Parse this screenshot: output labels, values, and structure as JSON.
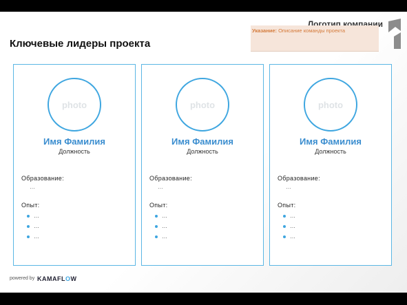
{
  "header": {
    "title": "Ключевые лидеры проекта",
    "logo_text": "Логотип компании",
    "note_label": "Указание:",
    "note_text": " Описание команды проекта"
  },
  "cards": [
    {
      "photo": "photo",
      "name": "Имя Фамилия",
      "position": "Должность",
      "education_label": "Образование:",
      "education_value": "…",
      "experience_label": "Опыт:",
      "experience_items": [
        "…",
        "…",
        "…"
      ]
    },
    {
      "photo": "photo",
      "name": "Имя Фамилия",
      "position": "Должность",
      "education_label": "Образование:",
      "education_value": "…",
      "experience_label": "Опыт:",
      "experience_items": [
        "…",
        "…",
        "…"
      ]
    },
    {
      "photo": "photo",
      "name": "Имя Фамилия",
      "position": "Должность",
      "education_label": "Образование:",
      "education_value": "…",
      "experience_label": "Опыт:",
      "experience_items": [
        "…",
        "…",
        "…"
      ]
    }
  ],
  "footer": {
    "powered_by": "powered by",
    "brand": "KAMAFL",
    "brand_o": "O",
    "brand_end": "W"
  },
  "colors": {
    "accent": "#3ea6e0",
    "name": "#3a8dcf",
    "note_bg": "#f6e5da",
    "note_text": "#d47a3a"
  }
}
